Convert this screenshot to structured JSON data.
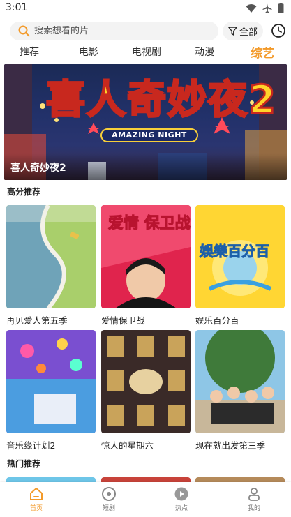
{
  "status": {
    "time": "3:01"
  },
  "search": {
    "placeholder": "搜索想看的片"
  },
  "filter": {
    "label": "全部"
  },
  "tabs": [
    {
      "label": "推荐",
      "active": false
    },
    {
      "label": "电影",
      "active": false
    },
    {
      "label": "电视剧",
      "active": false
    },
    {
      "label": "动漫",
      "active": false
    },
    {
      "label": "综艺",
      "active": true
    }
  ],
  "banner": {
    "art_title": "喜人奇妙夜2",
    "art_subtitle": "AMAZING NIGHT",
    "caption": "喜人奇妙夜2"
  },
  "sections": {
    "high_score": {
      "title": "高分推荐"
    },
    "hot": {
      "title": "热门推荐"
    }
  },
  "cards": [
    {
      "name": "再见爱人第五季",
      "art_text": "",
      "bg": "#8fbf5a"
    },
    {
      "name": "爱情保卫战",
      "art_text": "爱情 保卫战",
      "bg": "#e0244d"
    },
    {
      "name": "娱乐百分百",
      "art_text": "娛樂百分百",
      "bg": "#ffd633"
    },
    {
      "name": "音乐缘计划2",
      "art_text": "",
      "bg": "#4b9de0"
    },
    {
      "name": "惊人的星期六",
      "art_text": "",
      "bg": "#3a2a28"
    },
    {
      "name": "现在就出发第三季",
      "art_text": "",
      "bg": "#3f7a3a"
    }
  ],
  "bottom_nav": [
    {
      "label": "首页",
      "icon": "home-icon",
      "active": true
    },
    {
      "label": "短剧",
      "icon": "short-drama-icon",
      "active": false
    },
    {
      "label": "热点",
      "icon": "hot-play-icon",
      "active": false
    },
    {
      "label": "我的",
      "icon": "profile-icon",
      "active": false
    }
  ],
  "colors": {
    "accent": "#f39a2a",
    "search_bg": "#f3f3f3"
  }
}
